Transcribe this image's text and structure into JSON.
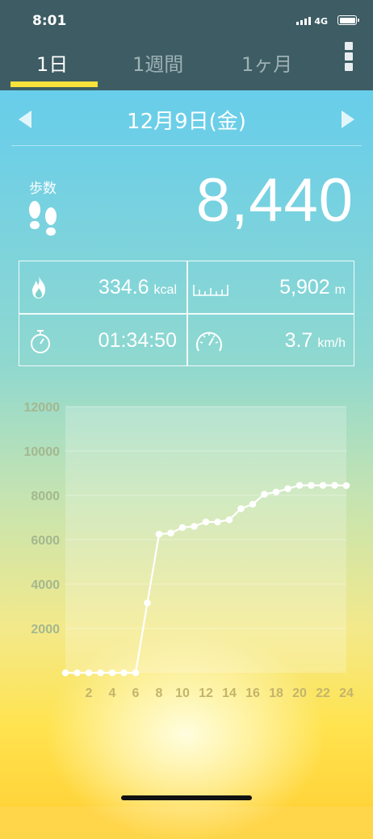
{
  "status_bar": {
    "time": "8:01",
    "network": "4G"
  },
  "tabs": [
    {
      "label": "1日",
      "active": true
    },
    {
      "label": "1週間",
      "active": false
    },
    {
      "label": "1ヶ月",
      "active": false
    }
  ],
  "date_nav": {
    "date": "12月9日(金)"
  },
  "steps": {
    "label": "歩数",
    "value": "8,440"
  },
  "metrics": {
    "calories": {
      "value": "334.6",
      "unit": "kcal",
      "icon": "flame-icon"
    },
    "distance": {
      "value": "5,902",
      "unit": "m",
      "icon": "ruler-icon"
    },
    "duration": {
      "value": "01:34:50",
      "icon": "stopwatch-icon"
    },
    "speed": {
      "value": "3.7",
      "unit": "km/h",
      "icon": "speedometer-icon"
    }
  },
  "colors": {
    "header": "#3d5c63",
    "accent": "#f9e23b"
  },
  "chart_data": {
    "type": "line",
    "xticks": [
      "2",
      "4",
      "6",
      "8",
      "10",
      "12",
      "14",
      "16",
      "18",
      "20",
      "22",
      "24"
    ],
    "yticks": [
      "2000",
      "4000",
      "6000",
      "8000",
      "10000",
      "12000"
    ],
    "xlim": [
      0,
      24
    ],
    "ylim": [
      0,
      12000
    ],
    "grid": true,
    "series": [
      {
        "x": [
          0,
          1,
          2,
          3,
          4,
          5,
          6,
          7,
          8,
          9,
          10,
          11,
          12,
          13,
          14,
          15,
          16,
          17,
          18,
          19,
          20,
          21,
          22,
          23,
          24
        ],
        "values": [
          0,
          0,
          0,
          0,
          0,
          0,
          0,
          3150,
          6250,
          6300,
          6550,
          6600,
          6800,
          6800,
          6900,
          7400,
          7600,
          8050,
          8150,
          8300,
          8450,
          8450,
          8450,
          8450,
          8440
        ]
      }
    ]
  }
}
